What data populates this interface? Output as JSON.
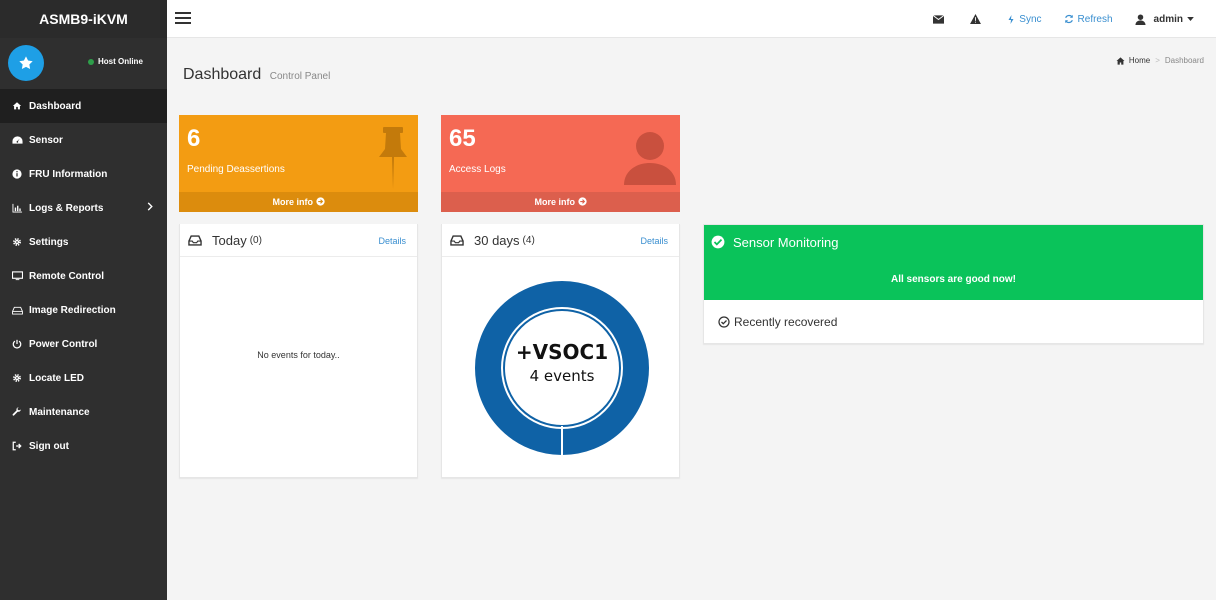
{
  "sidebar": {
    "brand": "ASMB9-iKVM",
    "host_status": "Host Online",
    "items": [
      {
        "label": "Dashboard",
        "icon": "home-icon"
      },
      {
        "label": "Sensor",
        "icon": "dashboard-gauge-icon"
      },
      {
        "label": "FRU Information",
        "icon": "info-circle-icon"
      },
      {
        "label": "Logs & Reports",
        "icon": "bar-chart-icon"
      },
      {
        "label": "Settings",
        "icon": "gear-icon"
      },
      {
        "label": "Remote Control",
        "icon": "monitor-icon"
      },
      {
        "label": "Image Redirection",
        "icon": "hdd-icon"
      },
      {
        "label": "Power Control",
        "icon": "power-icon"
      },
      {
        "label": "Locate LED",
        "icon": "gear-icon"
      },
      {
        "label": "Maintenance",
        "icon": "wrench-icon"
      },
      {
        "label": "Sign out",
        "icon": "sign-out-icon"
      }
    ]
  },
  "header": {
    "sync_label": "Sync",
    "refresh_label": "Refresh",
    "user_label": "admin"
  },
  "page": {
    "title": "Dashboard",
    "subtitle": "Control Panel",
    "breadcrumb_home": "Home",
    "breadcrumb_current": "Dashboard"
  },
  "boxes": {
    "pending": {
      "value": "6",
      "label": "Pending Deassertions",
      "footer": "More info"
    },
    "access": {
      "value": "65",
      "label": "Access Logs",
      "footer": "More info"
    }
  },
  "today": {
    "title": "Today",
    "count": "(0)",
    "details": "Details",
    "empty": "No events for today.."
  },
  "thirty_days": {
    "title": "30 days",
    "count": "(4)",
    "details": "Details",
    "donut_title": "+VSOC1",
    "donut_subtitle": "4 events"
  },
  "sensor_monitoring": {
    "title": "Sensor Monitoring",
    "message": "All sensors are good now!",
    "recent": "Recently recovered"
  },
  "colors": {
    "orange": "#f39c12",
    "red": "#f56954",
    "green": "#0ac35a",
    "blue": "#0f62a6",
    "link": "#3a8fd0"
  }
}
